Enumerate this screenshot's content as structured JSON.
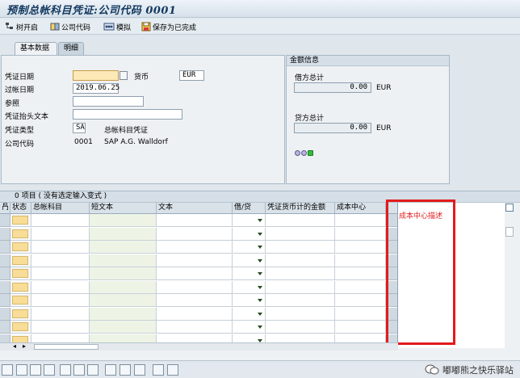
{
  "title": "预制总帐科目凭证:公司代码 0001",
  "toolbar": {
    "tree_on": "树开启",
    "company_code": "公司代码",
    "simulate": "模拟",
    "save_complete": "保存为已完成"
  },
  "tabs": {
    "basic": "基本数据",
    "details": "明细"
  },
  "basic": {
    "doc_date_label": "凭证日期",
    "doc_date_value": "",
    "currency_label": "货币",
    "currency_value": "EUR",
    "posting_date_label": "过帐日期",
    "posting_date_value": "2019.06.25",
    "reference_label": "参照",
    "reference_value": "",
    "header_text_label": "凭证抬头文本",
    "header_text_value": "",
    "doc_type_label": "凭证类型",
    "doc_type_value": "SA",
    "doc_type_desc": "总帐科目凭证",
    "company_code_label": "公司代码",
    "company_code_value": "0001",
    "company_name": "SAP A.G. Walldorf"
  },
  "amount": {
    "title": "金额信息",
    "debit_label": "借方总计",
    "debit_value": "0.00",
    "debit_currency": "EUR",
    "credit_label": "贷方总计",
    "credit_value": "0.00",
    "credit_currency": "EUR"
  },
  "grid": {
    "title": "0 项目 ( 没有选定输入变式 )",
    "columns": {
      "status": "状态",
      "gl_account": "总帐科目",
      "short_text": "短文本",
      "text": "文本",
      "dc": "借/贷",
      "amount": "凭证货币计的金额",
      "cost_center": "成本中心"
    },
    "annotation": "成本中心描述"
  },
  "watermark": "嘟嘟熊之快乐驿站",
  "colors": {
    "annotation": "#e21b1b",
    "required": "#fbe9b7",
    "title": "#12385e"
  }
}
